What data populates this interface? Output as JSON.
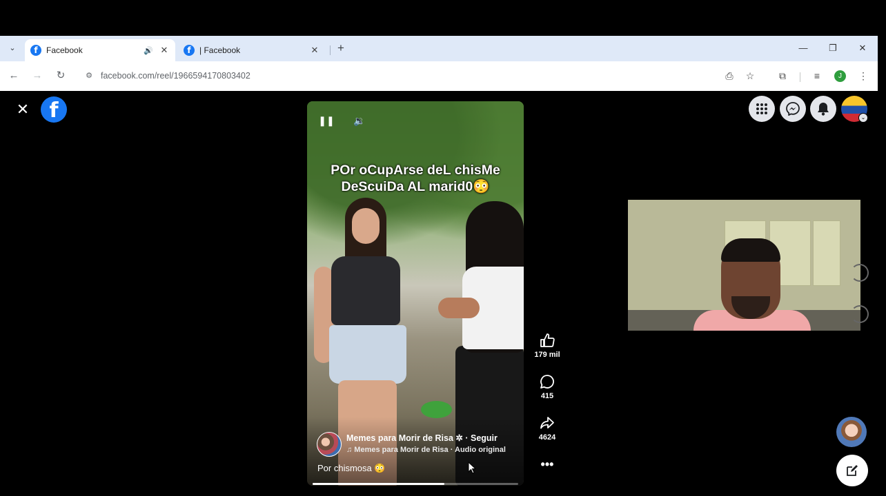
{
  "browser": {
    "tabs": [
      {
        "title": "Facebook",
        "active": true,
        "audio": true
      },
      {
        "title": "| Facebook",
        "active": false,
        "audio": false
      }
    ],
    "url": "facebook.com/reel/1966594170803402",
    "profile_initial": "J"
  },
  "reel": {
    "caption_line1": "POr oCupArse deL chisMe",
    "caption_line2": "DeScuiDa AL marid0😳",
    "page_name": "Memes para Morir de Risa",
    "follow_label": "· Seguir",
    "audio_line": "♫ Memes para Morir de Risa · Audio original",
    "description": "Por chismosa 😳",
    "progress_fraction": 0.64
  },
  "actions": {
    "likes": "179 mil",
    "comments": "415",
    "shares": "4624"
  },
  "icons": {
    "close": "close-icon",
    "facebook": "facebook-logo-icon",
    "menu": "apps-grid-icon",
    "messenger": "messenger-icon",
    "notifications": "bell-icon",
    "like": "thumbs-up-icon",
    "comment": "comment-icon",
    "share": "share-icon",
    "more": "more-horizontal-icon",
    "compose": "compose-icon"
  },
  "colors": {
    "facebook_blue": "#1877f2",
    "tabstrip": "#dfe9f8",
    "background": "#000000"
  }
}
